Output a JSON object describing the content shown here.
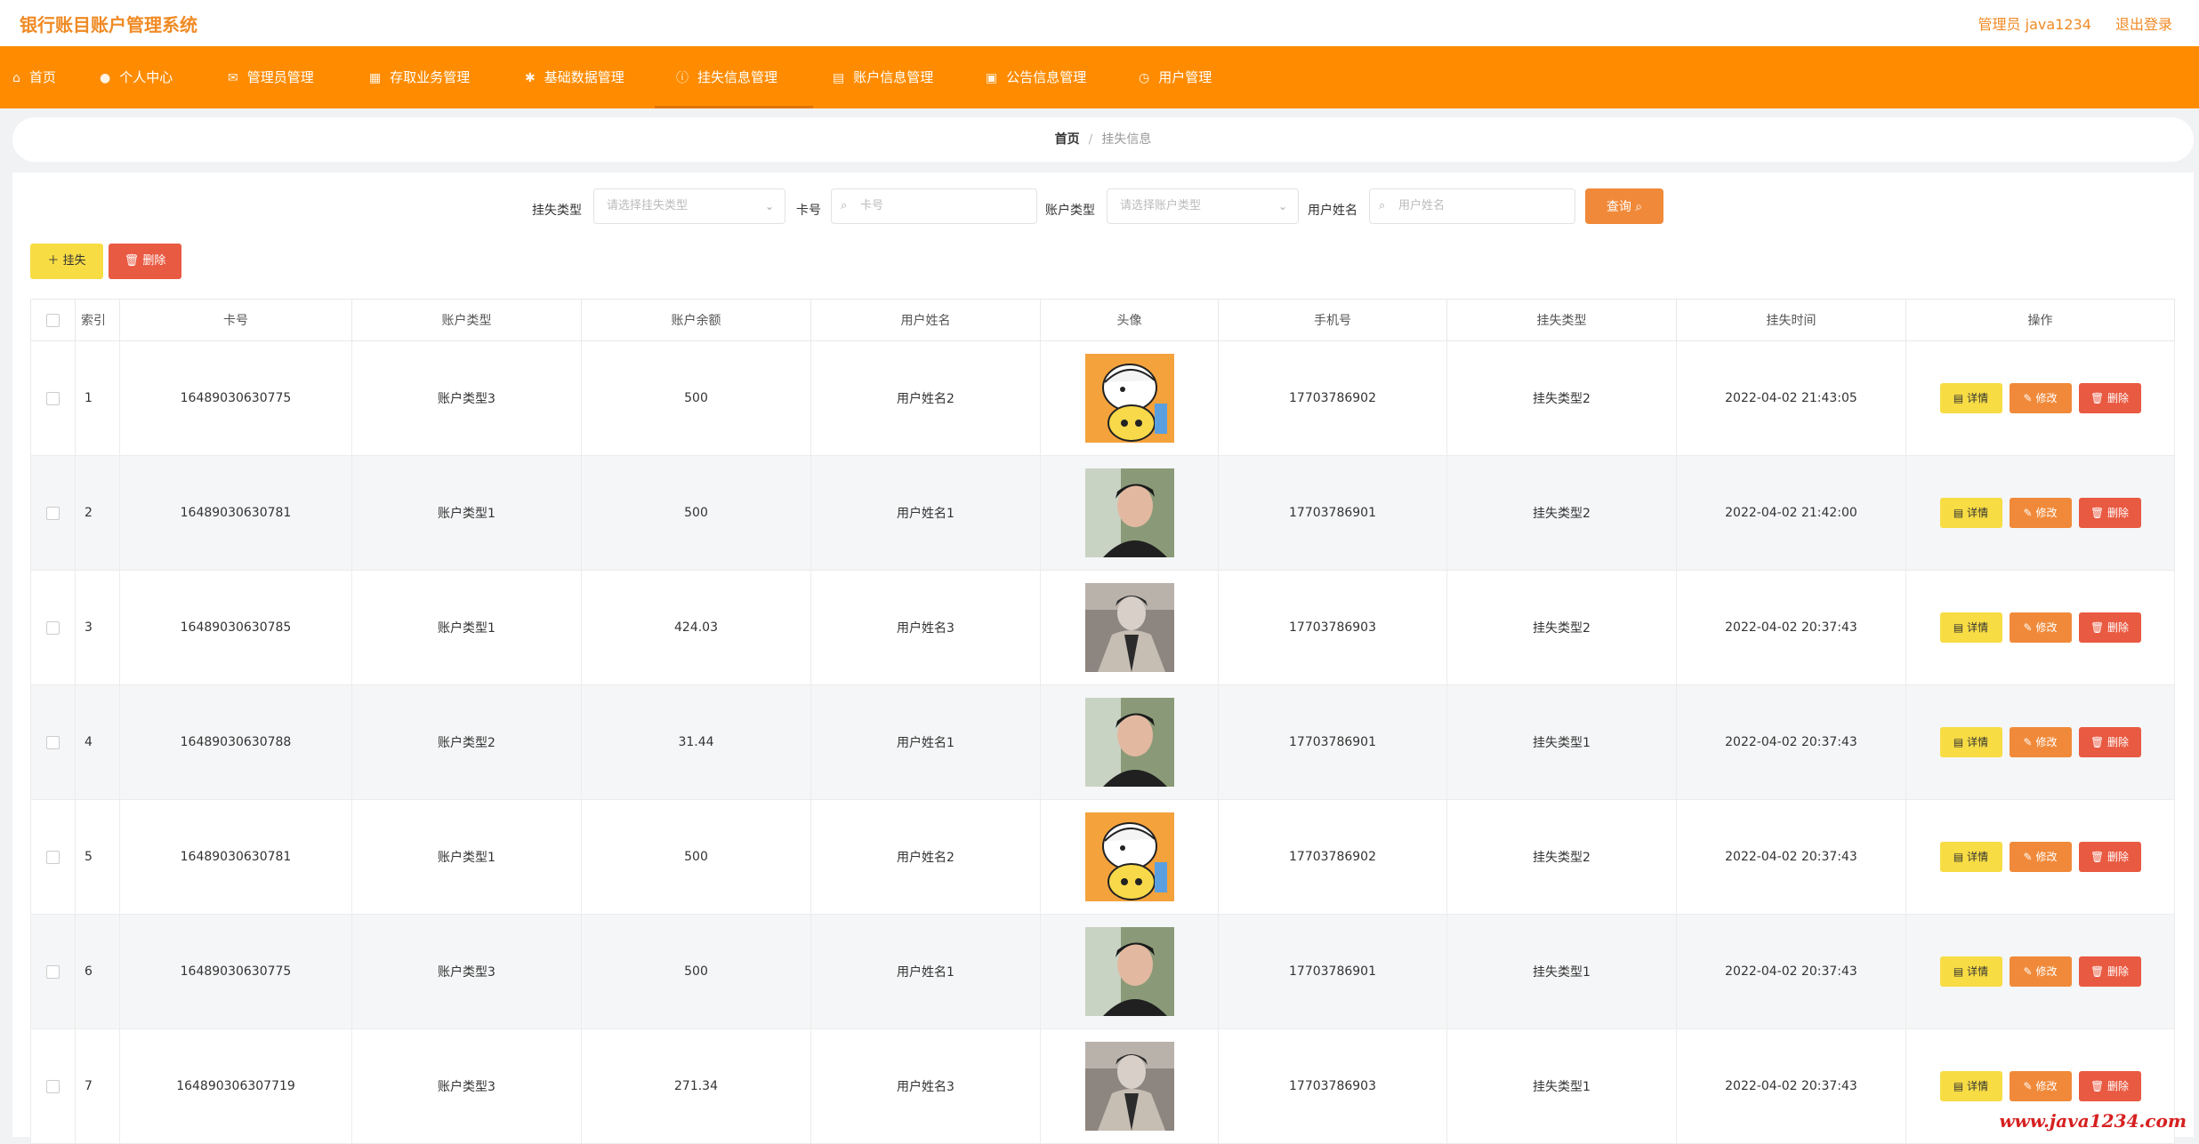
{
  "header": {
    "app_title": "银行账目账户管理系统",
    "user_label": "管理员 java1234",
    "logout_label": "退出登录"
  },
  "nav": [
    {
      "label": "首页",
      "icon": "home-icon"
    },
    {
      "label": "个人中心",
      "icon": "user-icon"
    },
    {
      "label": "管理员管理",
      "icon": "mail-icon"
    },
    {
      "label": "存取业务管理",
      "icon": "grid-icon"
    },
    {
      "label": "基础数据管理",
      "icon": "gear-icon"
    },
    {
      "label": "挂失信息管理",
      "icon": "info-icon",
      "active": true
    },
    {
      "label": "账户信息管理",
      "icon": "document-icon"
    },
    {
      "label": "公告信息管理",
      "icon": "briefcase-icon"
    },
    {
      "label": "用户管理",
      "icon": "clock-icon"
    }
  ],
  "breadcrumb": {
    "home": "首页",
    "separator": "/",
    "current": "挂失信息"
  },
  "search": {
    "loss_type_label": "挂失类型",
    "loss_type_placeholder": "请选择挂失类型",
    "card_label": "卡号",
    "card_placeholder": "卡号",
    "account_type_label": "账户类型",
    "account_type_placeholder": "请选择账户类型",
    "username_label": "用户姓名",
    "username_placeholder": "用户姓名",
    "query_label": "查询"
  },
  "actions": {
    "add_label": "挂失",
    "delete_label": "删除"
  },
  "table": {
    "columns": [
      "索引",
      "卡号",
      "账户类型",
      "账户余额",
      "用户姓名",
      "头像",
      "手机号",
      "挂失类型",
      "挂失时间",
      "操作"
    ],
    "op_labels": {
      "detail": "详情",
      "edit": "修改",
      "delete": "删除"
    },
    "rows": [
      {
        "index": "1",
        "card": "16489030630775",
        "account_type": "账户类型3",
        "balance": "500",
        "username": "用户姓名2",
        "avatar": "cartoon",
        "phone": "17703786902",
        "loss_type": "挂失类型2",
        "time": "2022-04-02 21:43:05"
      },
      {
        "index": "2",
        "card": "16489030630781",
        "account_type": "账户类型1",
        "balance": "500",
        "username": "用户姓名1",
        "avatar": "man-dark",
        "phone": "17703786901",
        "loss_type": "挂失类型2",
        "time": "2022-04-02 21:42:00"
      },
      {
        "index": "3",
        "card": "16489030630785",
        "account_type": "账户类型1",
        "balance": "424.03",
        "username": "用户姓名3",
        "avatar": "man-coat",
        "phone": "17703786903",
        "loss_type": "挂失类型2",
        "time": "2022-04-02 20:37:43"
      },
      {
        "index": "4",
        "card": "16489030630788",
        "account_type": "账户类型2",
        "balance": "31.44",
        "username": "用户姓名1",
        "avatar": "man-dark",
        "phone": "17703786901",
        "loss_type": "挂失类型1",
        "time": "2022-04-02 20:37:43"
      },
      {
        "index": "5",
        "card": "16489030630781",
        "account_type": "账户类型1",
        "balance": "500",
        "username": "用户姓名2",
        "avatar": "cartoon",
        "phone": "17703786902",
        "loss_type": "挂失类型2",
        "time": "2022-04-02 20:37:43"
      },
      {
        "index": "6",
        "card": "16489030630775",
        "account_type": "账户类型3",
        "balance": "500",
        "username": "用户姓名1",
        "avatar": "man-dark",
        "phone": "17703786901",
        "loss_type": "挂失类型1",
        "time": "2022-04-02 20:37:43"
      },
      {
        "index": "7",
        "card": "164890306307719",
        "account_type": "账户类型3",
        "balance": "271.34",
        "username": "用户姓名3",
        "avatar": "man-coat",
        "phone": "17703786903",
        "loss_type": "挂失类型1",
        "time": "2022-04-02 20:37:43"
      }
    ]
  },
  "watermark": "www.java1234.com",
  "colors": {
    "brand": "#ff8c00",
    "accent": "#f08a24",
    "yellow": "#f7dc44",
    "orange": "#f08a3a",
    "red": "#e95a42"
  }
}
